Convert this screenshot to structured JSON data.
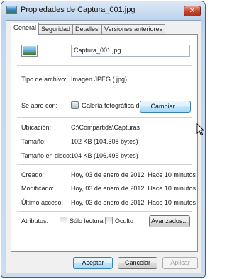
{
  "window": {
    "title": "Propiedades de Captura_001.jpg",
    "close_label": "✕"
  },
  "tabs": [
    {
      "label": "General",
      "active": true
    },
    {
      "label": "Seguridad",
      "active": false
    },
    {
      "label": "Detalles",
      "active": false
    },
    {
      "label": "Versiones anteriores",
      "active": false
    }
  ],
  "general": {
    "file_name": "Captura_001.jpg",
    "file_type_label": "Tipo de archivo:",
    "file_type_value": "Imagen JPEG (.jpg)",
    "opens_with_label": "Se abre con:",
    "opens_with_value": "Galería fotográfica de Wi",
    "change_button": "Cambiar...",
    "location_label": "Ubicación:",
    "location_value": "C:\\Compartida\\Capturas",
    "size_label": "Tamaño:",
    "size_value": "102 KB (104.508 bytes)",
    "size_on_disk_label": "Tamaño en disco:",
    "size_on_disk_value": "104 KB (106.496 bytes)",
    "created_label": "Creado:",
    "created_value": "Hoy, 03 de enero de 2012, Hace 10 minutos",
    "modified_label": "Modificado:",
    "modified_value": "Hoy, 03 de enero de 2012, Hace 10 minutos",
    "accessed_label": "Último acceso:",
    "accessed_value": "Hoy, 03 de enero de 2012, Hace 10 minutos",
    "attributes_label": "Atributos:",
    "readonly_label": "Sólo lectura",
    "readonly_checked": false,
    "hidden_label": "Oculto",
    "hidden_checked": false,
    "advanced_button": "Avanzados..."
  },
  "footer": {
    "accept": "Aceptar",
    "cancel": "Cancelar",
    "apply": "Aplicar"
  }
}
